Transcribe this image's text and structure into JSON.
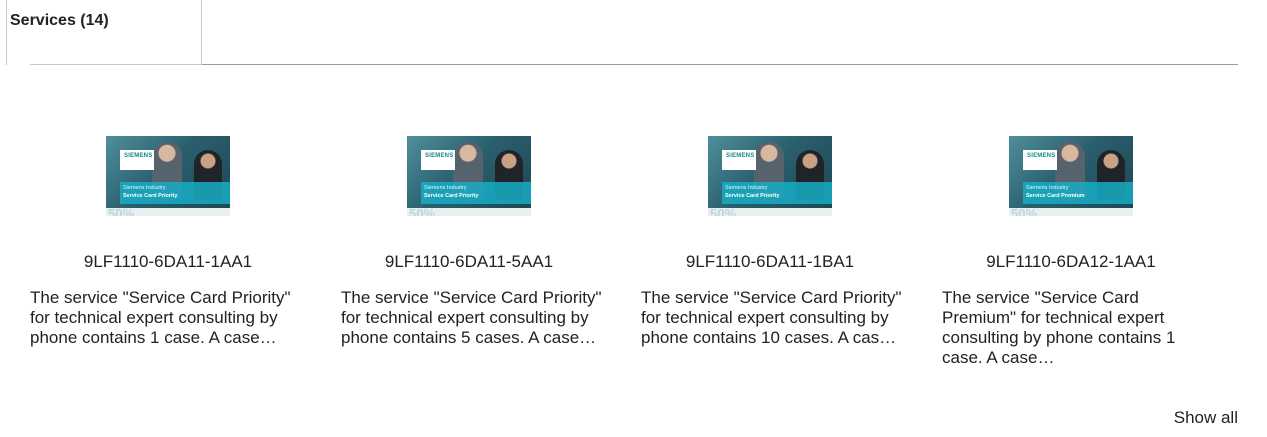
{
  "tab": {
    "label": "Services (14)"
  },
  "cards": [
    {
      "code": "9LF1110-6DA11-1AA1",
      "description": "The service \"Service Card Priority\" for technical expert consulting by phone contains 1 case. A case…",
      "thumb": {
        "logo": "SIEMENS",
        "line1": "Siemens Industry",
        "line2": "Service Card Priority",
        "badge": "50%"
      }
    },
    {
      "code": "9LF1110-6DA11-5AA1",
      "description": "The service \"Service Card Priority\" for technical expert consulting by phone contains 5 cases. A case…",
      "thumb": {
        "logo": "SIEMENS",
        "line1": "Siemens Industry",
        "line2": "Service Card Priority",
        "badge": "50%"
      }
    },
    {
      "code": "9LF1110-6DA11-1BA1",
      "description": "The service \"Service Card Priority\" for technical expert consulting by phone contains 10 cases. A cas…",
      "thumb": {
        "logo": "SIEMENS",
        "line1": "Siemens Industry",
        "line2": "Service Card Priority",
        "badge": "50%"
      }
    },
    {
      "code": "9LF1110-6DA12-1AA1",
      "description": "The service \"Service Card Premium\" for technical expert consulting by phone contains 1 case. A case…",
      "thumb": {
        "logo": "SIEMENS",
        "line1": "Siemens Industry",
        "line2": "Service Card Premium",
        "badge": "50%"
      }
    }
  ],
  "footer": {
    "show_all_label": "Show all"
  }
}
